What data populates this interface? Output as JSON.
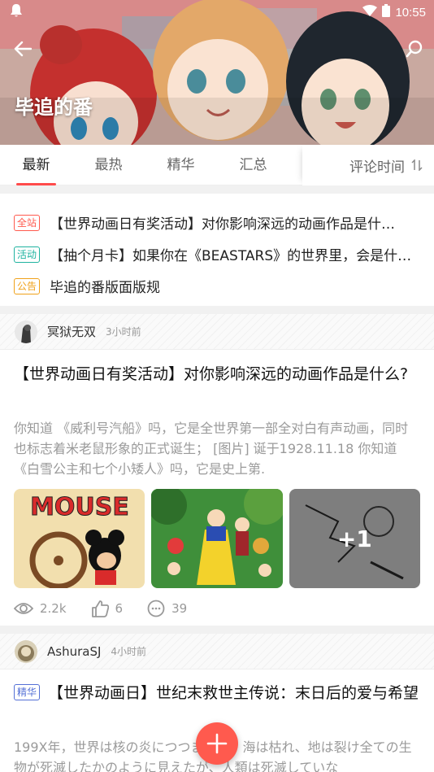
{
  "status_bar": {
    "time": "10:55"
  },
  "header": {
    "title": "毕追的番"
  },
  "tabs": [
    {
      "label": "最新"
    },
    {
      "label": "最热"
    },
    {
      "label": "精华"
    },
    {
      "label": "汇总"
    }
  ],
  "sort": {
    "label": "评论时间"
  },
  "notices": [
    {
      "tag": "全站",
      "color": "#ff5a4e",
      "text": "【世界动画日有奖活动】对你影响深远的动画作品是什…"
    },
    {
      "tag": "活动",
      "color": "#1fb3a0",
      "text": "【抽个月卡】如果你在《BEASTARS》的世界里，会是什…"
    },
    {
      "tag": "公告",
      "color": "#f0a21a",
      "text": "毕追的番版面版规"
    }
  ],
  "posts": [
    {
      "author": "冥狱无双",
      "time": "3小时前",
      "title": "【世界动画日有奖活动】对你影响深远的动画作品是什么?",
      "excerpt": "你知道 《威利号汽船》吗，它是全世界第一部全对白有声动画，同时也标志着米老鼠形象的正式诞生； [图片] 诞于1928.11.18 你知道 《白雪公主和七个小矮人》吗，它是史上第.",
      "more_count": "+1",
      "views": "2.2k",
      "likes": "6",
      "comments": "39"
    },
    {
      "author": "AshuraSJ",
      "time": "4小时前",
      "tag": "精华",
      "title": "【世界动画日】世纪末救世主传说：末日后的爱与希望",
      "excerpt": "199X年，世界は核の炎につつまれた。海は枯れ、地は裂け全ての生物が死滅したかのように見えたが、人類は死滅していな"
    }
  ],
  "colors": {
    "accent": "#ff4b4b",
    "fab": "#ff5a4e"
  }
}
